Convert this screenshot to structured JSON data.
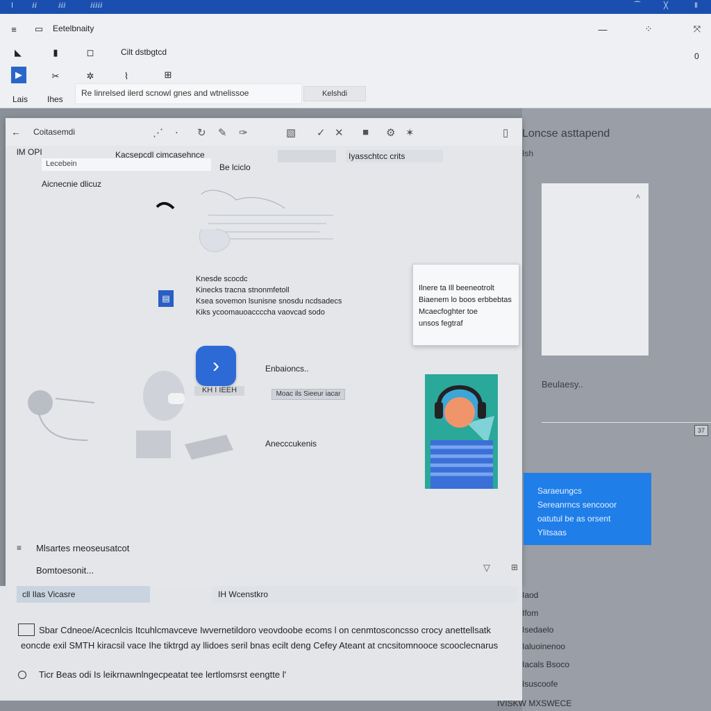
{
  "titlebar": {
    "items": [
      "Ⅰ",
      "ⅈⅈ",
      "ⅈⅈⅈ",
      "ⅈⅈⅈⅈⅈ"
    ],
    "right_items": [
      "⁀",
      "╳",
      "Ⅱ"
    ]
  },
  "ribbon": {
    "doc_title": "Eetelbnaity",
    "label_text": "Cilt dstbgtcd",
    "zero": "0",
    "tab_a": "Lais",
    "tab_b": "Ihes",
    "search_value": "Re linrelsed ilerd scnowl gnes and wtnelissoe",
    "action_button": "Kelshdi"
  },
  "dialog": {
    "title": "Coitasemdi",
    "mode_label": "lM OPI",
    "heading": "Kacsepcdl cimcasehnce",
    "header_chip": "Iyasschtcc crits",
    "input_value": "Lecebein",
    "subhead": "Be lciclo",
    "field_label": "Aicnecnie dlicuz",
    "description": [
      "Knesde scocdc",
      "Kinecks tracna stnonmfetoll",
      "Ksea sovemon lsunisne snosdu ncdsadecs",
      "Kiks ycoomauoaccccha vaovcad sodo"
    ],
    "tile_label": "KH I IEEH",
    "primary_link": "Enbaioncs..",
    "tag_label": "Moac ils Sieeur iacar",
    "secondary_link": "Anecccukenis",
    "footer_title": "Mlsartes rneoseusatcot",
    "footer_sub": "Bomtoesonit..."
  },
  "tooltip": {
    "lines": [
      "Ilnere ta Ill beeneotrolt",
      "Biaenem lo boos erbbebtas",
      "Mcaecfoghter toe",
      "unsos fegtraf"
    ]
  },
  "right_panel": {
    "heading": "Loncse asttapend",
    "sub": "Ish",
    "side_text": "Beulaesy..",
    "counter": "37",
    "list": [
      "Iaod",
      "Ifom",
      "Isedaelo",
      "Ialuoinenoo",
      "Iacals Bsoco",
      "Isuscoofe",
      "IVISKW MXSWECE"
    ]
  },
  "info_card": {
    "lines": [
      "Saraeungcs",
      "Sereanrncs sencooor",
      "oatutul be as orsent",
      "Ylitsaas"
    ]
  },
  "bottom": {
    "card_a": "cll Ilas Vicasre",
    "card_b": "IH Wcenstkro",
    "line_1": "Sbar Cdneoe/Acecnlcis Itcuhlcmavceve Iwvernetildoro veovdoobe ecoms l on cenmtosconcsso crocy anettellsatk",
    "line_2": "eoncde exil SMTH kiracsil vace Ihe tiktrgd ay llidoes seril bnas ecilt deng Cefey Ateant at cncsitomnooce scooclecnarus",
    "line_3": "Ticr Beas odi Is leikrnawnlngecpeatat tee lertlomsrst eengtte l'"
  },
  "colors": {
    "accent": "#1a4fb0",
    "tile": "#2d6ad6",
    "info_card": "#1f7ee8"
  }
}
